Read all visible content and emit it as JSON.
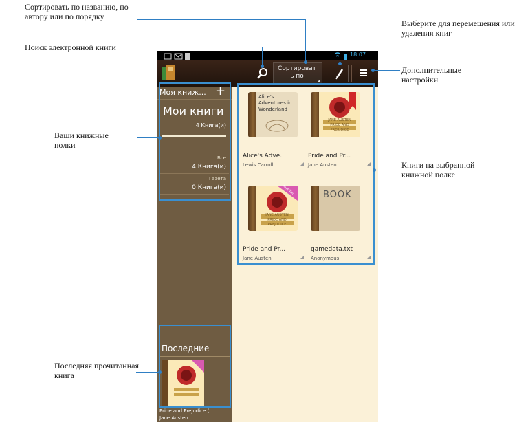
{
  "callouts": {
    "sort": "Сортировать по названию, по автору или по порядку",
    "search": "Поиск электронной книги",
    "select": "Выберите для перемещения или удаления книг",
    "settings": "Дополнительные настройки",
    "shelves": "Ваши книжные полки",
    "books": "Книги на выбранной книжной полке",
    "last": "Последняя прочитанная книга"
  },
  "status": {
    "time": "18:07"
  },
  "actionbar": {
    "sort_label": "Сортироват ь по"
  },
  "sidebar": {
    "header": "Моя книж...",
    "shelf_title": "Мои книги",
    "shelf_count": "4 Книга(и)",
    "categories": [
      {
        "name": "Все",
        "count": "4 Книга(и)"
      },
      {
        "name": "Газета",
        "count": "0 Книга(и)"
      }
    ],
    "recent_header": "Последние",
    "recent_title": "Pride and Prejudice (...",
    "recent_author": "Jane Austen"
  },
  "books": [
    {
      "title": "Alice's Adve...",
      "author": "Lewis Carroll",
      "cover_text": "Alice's Adventures in Wonderland"
    },
    {
      "title": "Pride and Pr...",
      "author": "Jane Austen",
      "cover_text": "JANE AUSTEN PRIDE AND PREJUDICE"
    },
    {
      "title": "Pride and Pr...",
      "author": "Jane Austen",
      "cover_text": "JANE AUSTEN PRIDE AND PREJUDICE",
      "badge": "Part Two"
    },
    {
      "title": "gamedata.txt",
      "author": "Anonymous",
      "cover_text": "BOOK"
    }
  ],
  "colors": {
    "highlight": "#3a8fd0",
    "sidebar": "#6f5c42",
    "shelf_bg": "#fbf1d8"
  }
}
